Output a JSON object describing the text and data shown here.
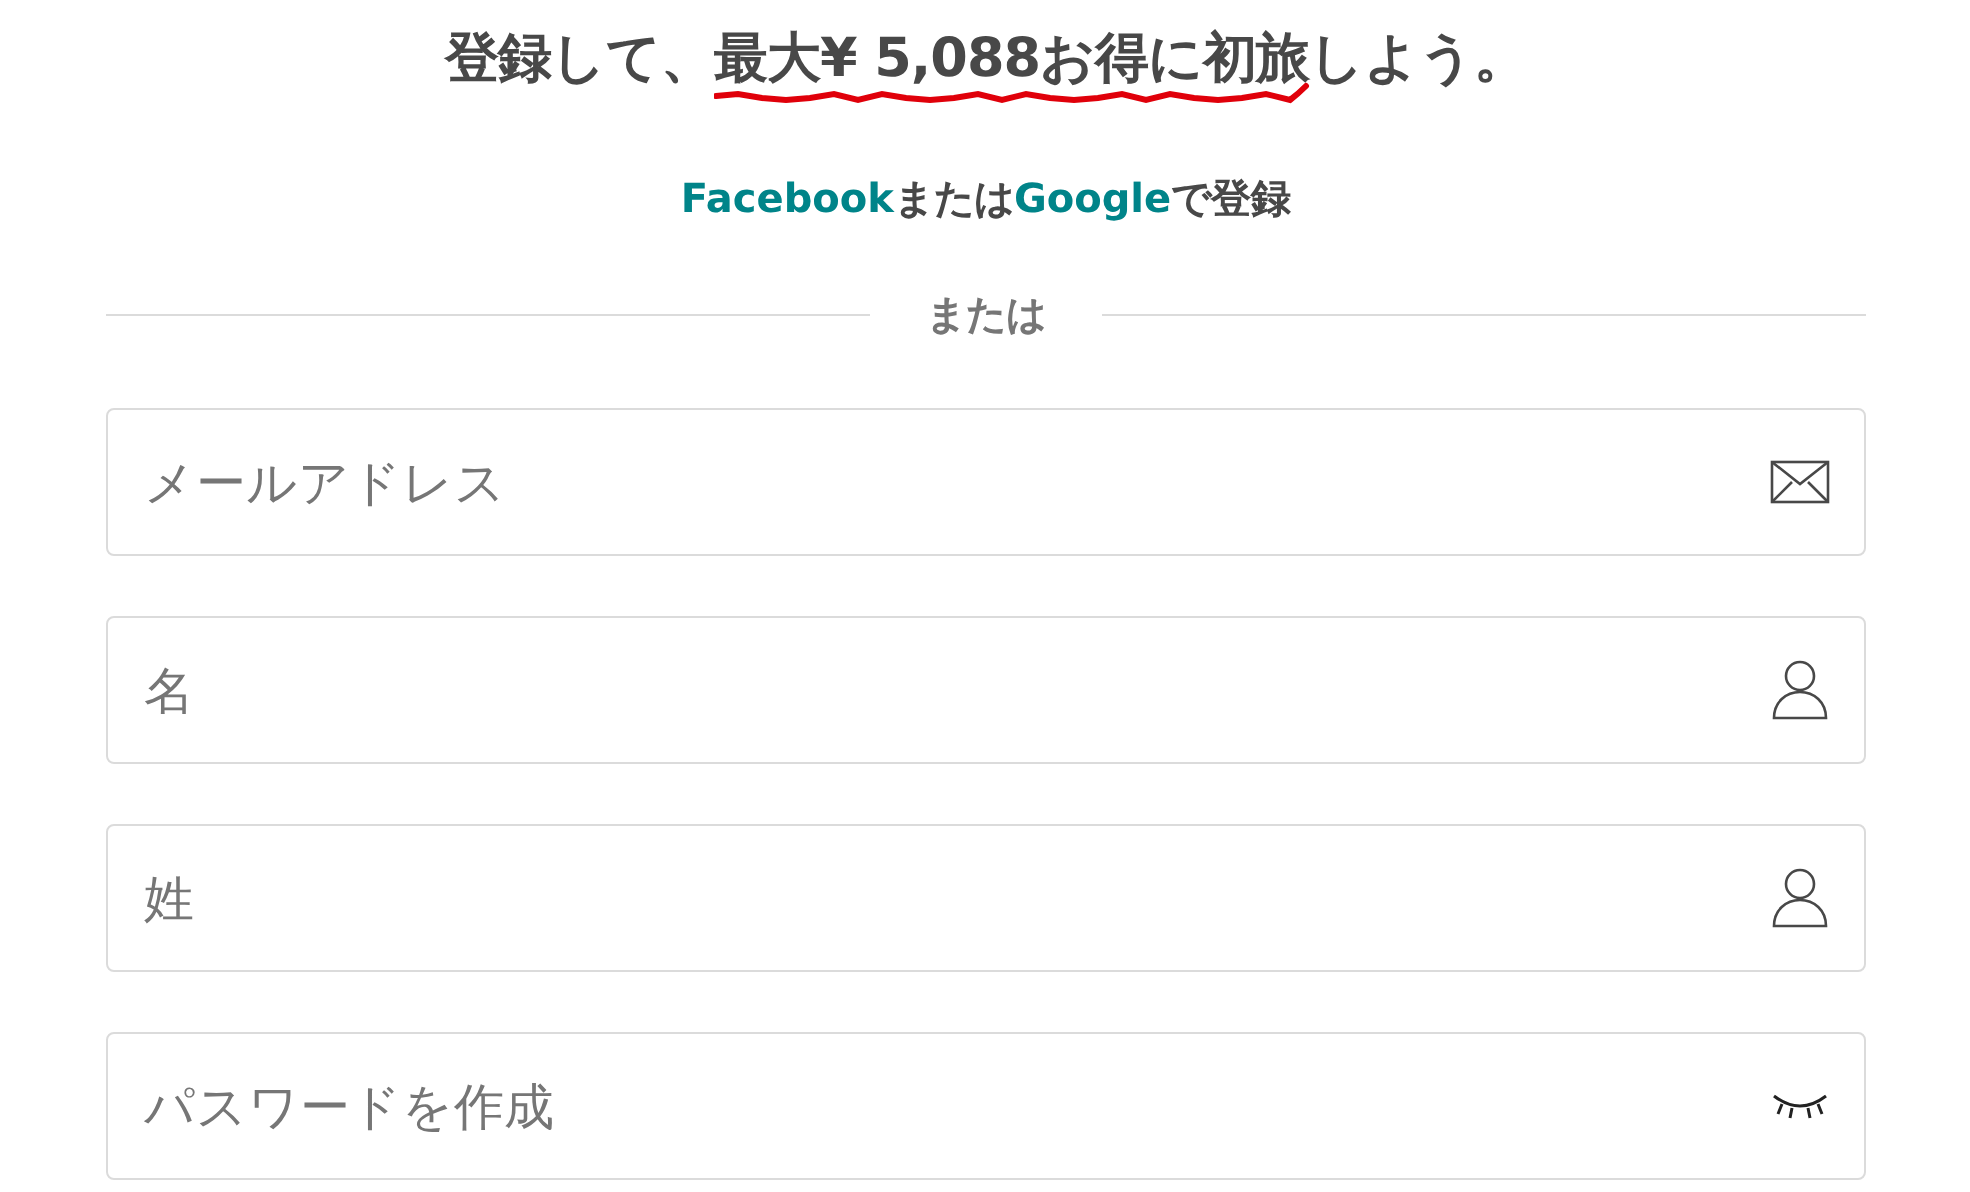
{
  "title": {
    "before": "登録して、",
    "highlight": "最大¥ 5,088お得に初旅",
    "after": "しよう。"
  },
  "social": {
    "facebook": "Facebook",
    "or": "または",
    "google": "Google",
    "suffix": "で登録"
  },
  "divider": "または",
  "fields": [
    {
      "placeholder": "メールアドレス",
      "kind": "email"
    },
    {
      "placeholder": "名",
      "kind": "person"
    },
    {
      "placeholder": "姓",
      "kind": "person"
    },
    {
      "placeholder": "パスワードを作成",
      "kind": "password"
    }
  ]
}
